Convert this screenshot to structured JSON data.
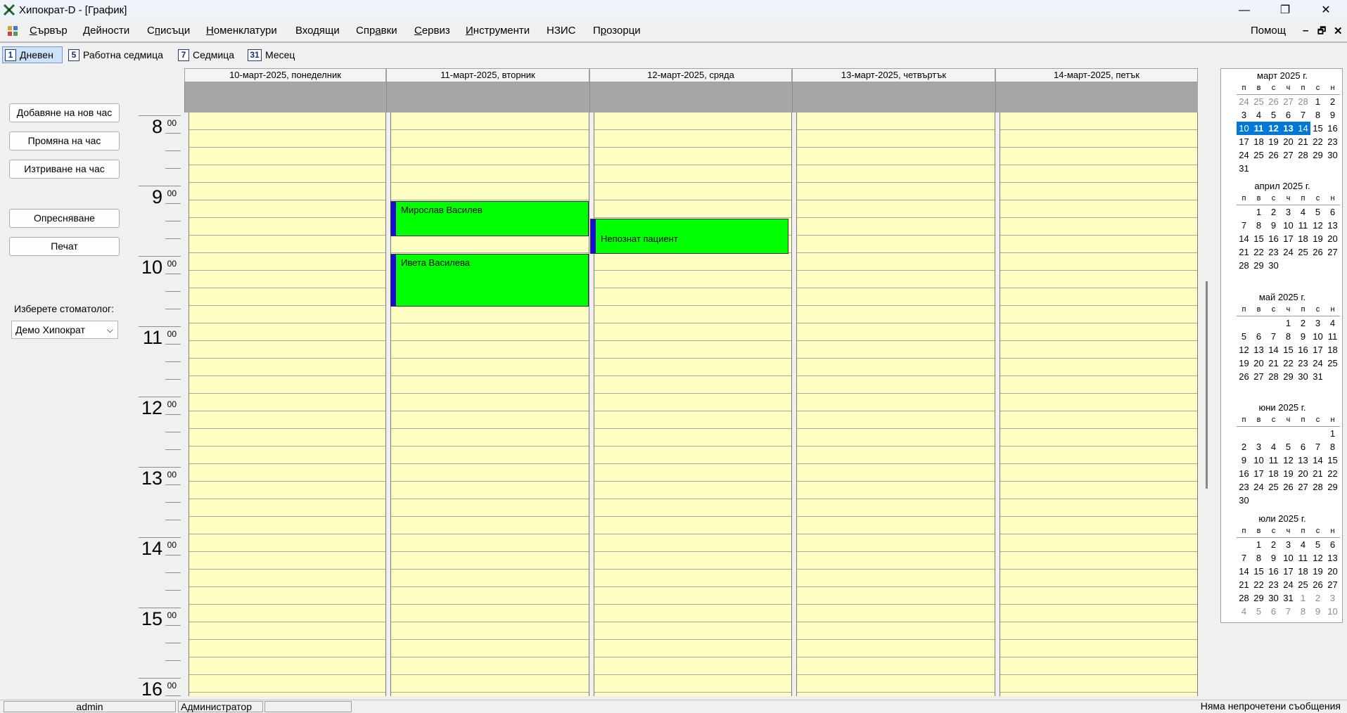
{
  "window": {
    "title": "Хипократ-D - [График]",
    "minimize": "—",
    "restore": "❐",
    "close": "✕"
  },
  "menu": {
    "items": [
      {
        "pre": "",
        "u": "С",
        "post": "ървър"
      },
      {
        "pre": "",
        "u": "Д",
        "post": "ейности"
      },
      {
        "pre": "С",
        "u": "п",
        "post": "исъци"
      },
      {
        "pre": "",
        "u": "Н",
        "post": "оменклатури"
      },
      {
        "pre": "Входящи",
        "u": "",
        "post": ""
      },
      {
        "pre": "Спр",
        "u": "а",
        "post": "вки"
      },
      {
        "pre": "",
        "u": "С",
        "post": "ервиз"
      },
      {
        "pre": "",
        "u": "И",
        "post": "нструменти"
      },
      {
        "pre": "НЗИС",
        "u": "",
        "post": ""
      },
      {
        "pre": "П",
        "u": "р",
        "post": "озорци"
      }
    ],
    "help": "Помощ",
    "mdi_min": "–",
    "mdi_restore": "🗗",
    "mdi_close": "✕"
  },
  "views": [
    {
      "num": "1",
      "label": "Дневен"
    },
    {
      "num": "5",
      "label": "Работна седмица"
    },
    {
      "num": "7",
      "label": "Седмица"
    },
    {
      "num": "31",
      "label": "Месец"
    }
  ],
  "active_view": "Дневен",
  "sidebar": {
    "add": "Добавяне на нов час",
    "edit": "Промяна на час",
    "delete": "Изтриване на час",
    "refresh": "Опресняване",
    "print": "Печат",
    "dentist_label": "Изберете стоматолог:",
    "dentist_value": "Демо Хипократ"
  },
  "hours": [
    "8",
    "9",
    "10",
    "11",
    "12",
    "13",
    "14",
    "15",
    "16"
  ],
  "minutes": "00",
  "days": [
    "10-март-2025, понеделник",
    "11-март-2025, вторник",
    "12-март-2025, сряда",
    "13-март-2025, четвъртък",
    "14-март-2025, петък"
  ],
  "appointments": [
    {
      "day": 1,
      "start": "9:15",
      "end": "9:45",
      "patient": "Мирослав Василев"
    },
    {
      "day": 1,
      "start": "10:00",
      "end": "10:45",
      "patient": "Ивета Василева"
    },
    {
      "day": 2,
      "start": "9:30",
      "end": "10:00",
      "patient": "Непознат пациент"
    }
  ],
  "calendar": {
    "dow": [
      "п",
      "в",
      "с",
      "ч",
      "п",
      "с",
      "н"
    ],
    "months": [
      {
        "title": "март 2025 г.",
        "lead": [
          "24",
          "25",
          "26",
          "27",
          "28"
        ],
        "days": 31,
        "trail": [],
        "bold": [
          "11",
          "12",
          "13"
        ],
        "selected": [
          "10",
          "11",
          "12",
          "13",
          "14"
        ]
      },
      {
        "title": "април 2025 г.",
        "lead": [
          ""
        ],
        "days": 30,
        "trail": [],
        "bold": [],
        "selected": []
      },
      {
        "title": "май 2025 г.",
        "lead": [
          "",
          "",
          ""
        ],
        "days": 31,
        "trail": [],
        "bold": [],
        "selected": []
      },
      {
        "title": "юни 2025 г.",
        "lead": [
          "",
          "",
          "",
          "",
          "",
          ""
        ],
        "days": 30,
        "trail": [],
        "bold": [],
        "selected": []
      },
      {
        "title": "юли 2025 г.",
        "lead": [
          ""
        ],
        "days": 31,
        "trail": [
          "1",
          "2",
          "3",
          "4",
          "5",
          "6",
          "7",
          "8",
          "9",
          "10"
        ],
        "bold": [],
        "selected": []
      }
    ]
  },
  "status": {
    "user": "admin",
    "role": "Администратор",
    "field3": "",
    "messages": "Няма непрочетени съобщения"
  },
  "colors": {
    "appointment": "#00ff00",
    "appointment_bar": "#1a0bd4",
    "slot_bg": "#ffffc4",
    "allday_bg": "#a6a6a6",
    "calendar_selected": "#0078d7"
  }
}
